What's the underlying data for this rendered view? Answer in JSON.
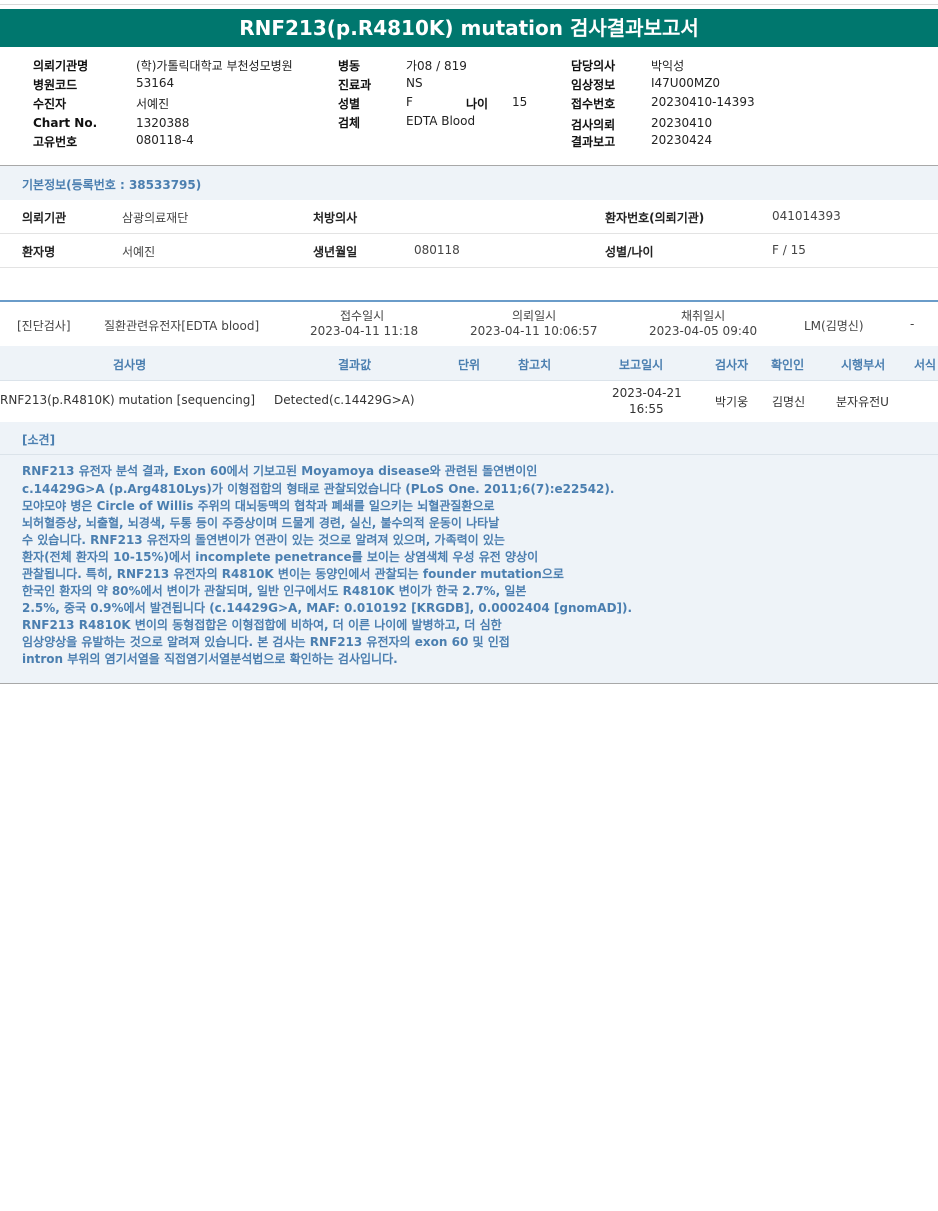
{
  "title": "RNF213(p.R4810K) mutation 검사결과보고서",
  "header": {
    "requesting_institution_label": "의뢰기관명",
    "requesting_institution_value": "(학)가톨릭대학교 부천성모병원",
    "hospital_code_label": "병원코드",
    "hospital_code_value": "53164",
    "examinee_label": "수진자",
    "examinee_value": "서예진",
    "chart_no_label": "Chart No.",
    "chart_no_value": "1320388",
    "unique_no_label": "고유번호",
    "unique_no_value": "080118-4",
    "ward_label": "병동",
    "ward_value": "가08 / 819",
    "dept_label": "진료과",
    "dept_value": "NS",
    "sex_label": "성별",
    "sex_value": "F",
    "age_label": "나이",
    "age_value": "15",
    "specimen_label": "검체",
    "specimen_value": "EDTA Blood",
    "doctor_label": "담당의사",
    "doctor_value": "박익성",
    "clinical_info_label": "임상정보",
    "clinical_info_value": "I47U00MZ0",
    "receipt_no_label": "접수번호",
    "receipt_no_value": "20230410-14393",
    "request_date_label": "검사의뢰",
    "request_date_value": "20230410",
    "report_date_label": "결과보고",
    "report_date_value": "20230424"
  },
  "basic_info": {
    "heading": "기본정보(등록번호 : 38533795)",
    "row1": {
      "inst_label": "의뢰기관",
      "inst_value": "삼광의료재단",
      "doctor_label": "처방의사",
      "doctor_value": "",
      "patient_no_label": "환자번호(의뢰기관)",
      "patient_no_value": "041014393"
    },
    "row2": {
      "name_label": "환자명",
      "name_value": "서예진",
      "dob_label": "생년월일",
      "dob_value": "080118",
      "sexage_label": "성별/나이",
      "sexage_value": "F / 15"
    }
  },
  "order": {
    "category": "[진단검사]",
    "test_group": "질환관련유전자[EDTA blood]",
    "received_label": "접수일시",
    "received_value": "2023-04-11 11:18",
    "requested_label": "의뢰일시",
    "requested_value": "2023-04-11 10:06:57",
    "collected_label": "채취일시",
    "collected_value": "2023-04-05 09:40",
    "lab": "LM(김명신)",
    "dash": "-"
  },
  "results_table": {
    "columns": [
      "검사명",
      "결과값",
      "단위",
      "참고치",
      "보고일시",
      "검사자",
      "확인인",
      "시행부서",
      "서식"
    ],
    "row": {
      "test_name": "RNF213(p.R4810K) mutation [sequencing]",
      "result": "Detected(c.14429G>A)",
      "unit": "",
      "reference": "",
      "report_date": "2023-04-21",
      "report_time": "16:55",
      "tester": "박기웅",
      "confirmer": "김명신",
      "dept": "분자유전U"
    }
  },
  "opinion": {
    "heading": "[소견]",
    "lines": [
      "RNF213 유전자 분석 결과, Exon 60에서 기보고된 Moyamoya disease와 관련된 돌연변이인",
      "c.14429G>A (p.Arg4810Lys)가 이형접합의 형태로 관찰되었습니다 (PLoS One. 2011;6(7):e22542).",
      "모야모야 병은 Circle of Willis 주위의 대뇌동맥의 협착과 폐쇄를 일으키는 뇌혈관질환으로",
      "뇌허혈증상, 뇌출혈, 뇌경색, 두통 등이 주증상이며 드물게 경련, 실신, 불수의적 운동이 나타날",
      "수 있습니다. RNF213 유전자의 돌연변이가 연관이 있는 것으로 알려져 있으며, 가족력이 있는",
      "환자(전체 환자의 10-15%)에서 incomplete penetrance를 보이는 상염색체 우성 유전 양상이",
      "관찰됩니다. 특히, RNF213 유전자의 R4810K 변이는 동양인에서 관찰되는 founder mutation으로",
      "한국인 환자의 약 80%에서 변이가 관찰되며, 일반 인구에서도 R4810K 변이가 한국 2.7%, 일본",
      "2.5%, 중국 0.9%에서 발견됩니다 (c.14429G>A, MAF: 0.010192 [KRGDB], 0.0002404 [gnomAD]).",
      "RNF213 R4810K 변이의 동형접합은 이형접합에 비하여, 더 이른 나이에 발병하고, 더 심한",
      "임상양상을 유발하는 것으로 알려져 있습니다. 본 검사는 RNF213 유전자의 exon 60 및 인접",
      "intron 부위의 염기서열을 직접염기서열분석법으로 확인하는 검사입니다."
    ]
  }
}
